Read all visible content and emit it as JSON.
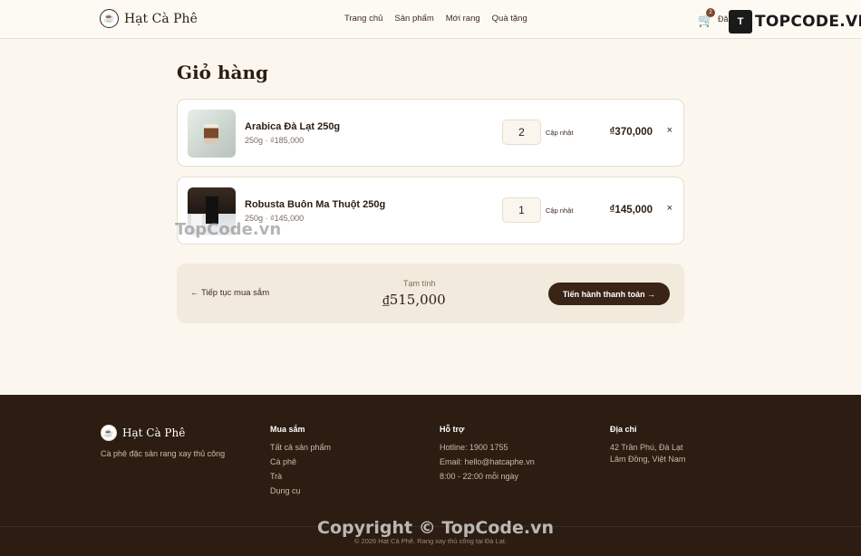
{
  "header": {
    "brand": "Hạt Cà Phê",
    "nav": [
      "Trang chủ",
      "Sản phẩm",
      "Mới rang",
      "Quà tặng"
    ],
    "cart_count": "2",
    "login": "Đă"
  },
  "watermark": {
    "logo_text": "TOPCODE.VN",
    "mid": "TopCode.vn",
    "copy": "Copyright © TopCode.vn"
  },
  "cart": {
    "title": "Giỏ hàng",
    "items": [
      {
        "name": "Arabica Đà Lạt 250g",
        "meta": "250g · ₫185,000",
        "qty": "2",
        "update": "Cập nhật",
        "price": "₫370,000",
        "remove": "×"
      },
      {
        "name": "Robusta Buôn Ma Thuột 250g",
        "meta": "250g · ₫145,000",
        "qty": "1",
        "update": "Cập nhật",
        "price": "₫145,000",
        "remove": "×"
      }
    ],
    "continue": "← Tiếp tục mua sắm",
    "subtotal_label": "Tạm tính",
    "subtotal": "₫515,000",
    "checkout": "Tiến hành thanh toán →"
  },
  "footer": {
    "brand": "Hạt Cà Phê",
    "tagline": "Cà phê đặc sản rang xay thủ công",
    "shop": {
      "title": "Mua sắm",
      "links": [
        "Tất cả sản phẩm",
        "Cà phê",
        "Trà",
        "Dụng cụ"
      ]
    },
    "support": {
      "title": "Hỗ trợ",
      "links": [
        "Hotline: 1900 1755",
        "Email: hello@hatcaphe.vn",
        "8:00 - 22:00 mỗi ngày"
      ]
    },
    "address": {
      "title": "Địa chỉ",
      "lines": [
        "42 Trần Phú, Đà Lạt",
        "Lâm Đồng, Việt Nam"
      ]
    },
    "copyright": "© 2026 Hạt Cà Phê. Rang xay thủ công tại Đà Lạt."
  }
}
